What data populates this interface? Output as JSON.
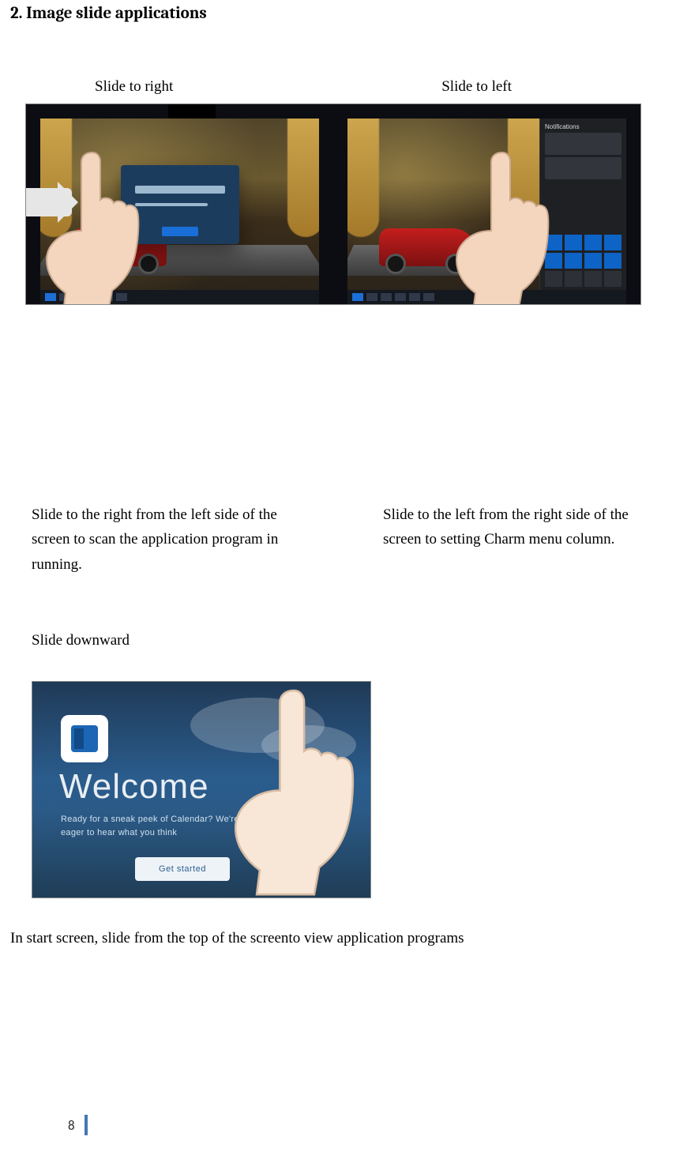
{
  "title": "2. Image slide applications",
  "labels": {
    "slide_right": "Slide to right",
    "slide_left": "Slide to left",
    "slide_down": "Slide downward"
  },
  "descriptions": {
    "right": "Slide to the right from the left side of the screen to scan the application program in running.",
    "left": "Slide to the left from the right side of the screen to setting Charm menu column."
  },
  "figure3": {
    "welcome": "Welcome",
    "sub_line1": "Ready for a sneak peek of Calendar? We're",
    "sub_line2": "eager to hear what you think",
    "cta": "Get started"
  },
  "notification_title": "Notifications",
  "bottom_text": "In start screen, slide from the top of the screento view application programs",
  "page_number": "8"
}
